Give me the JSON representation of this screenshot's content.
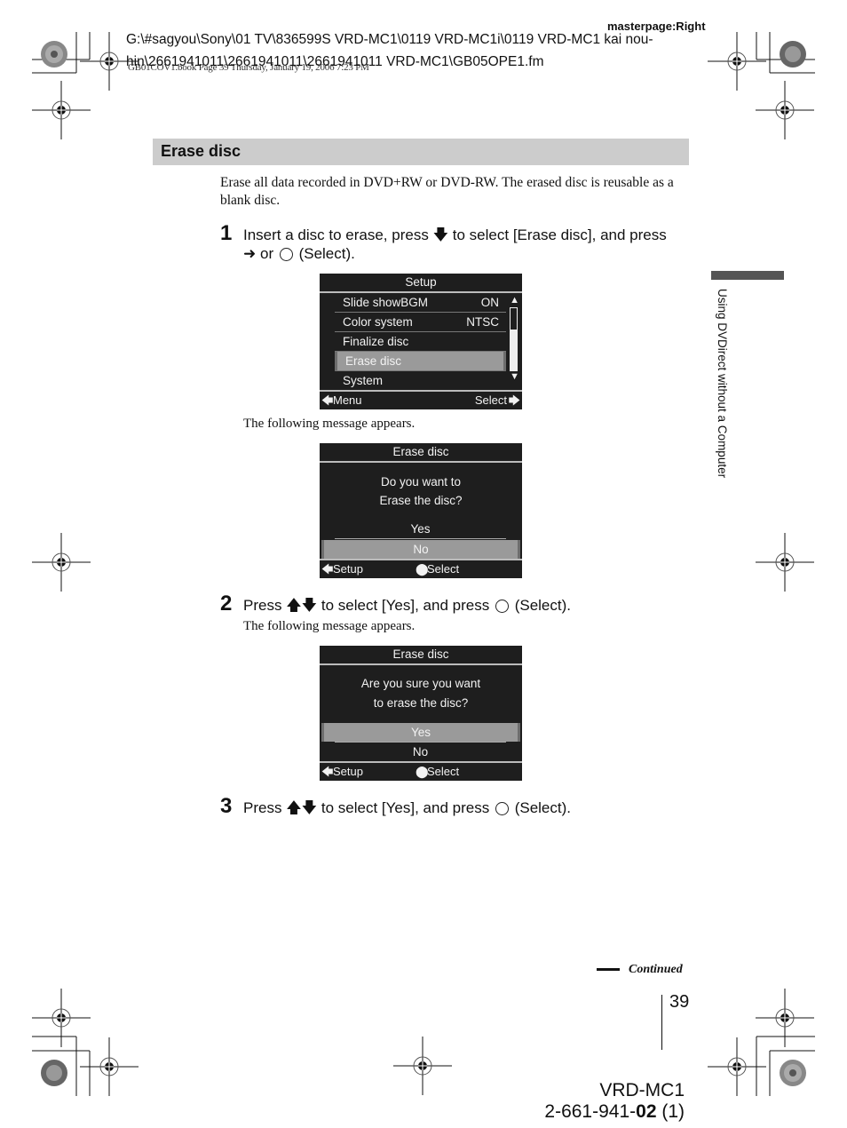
{
  "header": {
    "masterpage": "masterpage:Right",
    "path_line1": "G:\\#sagyou\\Sony\\01 TV\\836599S VRD-MC1\\0119 VRD-MC1i\\0119 VRD-MC1 kai nou-",
    "path_line2": "hin\\2661941011\\2661941011\\2661941011 VRD-MC1\\GB05OPE1.fm",
    "book_line": "GB01COV1.book  Page 39  Thursday, January 19, 2006  7:23 PM"
  },
  "section": {
    "title": "Erase disc",
    "intro": "Erase all data recorded in DVD+RW or DVD-RW. The erased disc is reusable as a blank disc."
  },
  "steps": [
    {
      "number": "1",
      "text_a": "Insert a disc to erase, press",
      "icon_a": "down-arrow",
      "text_b": "to select [Erase disc], and press",
      "icon_b": "right-arrow",
      "text_c": "or",
      "icon_c": "circle-button",
      "text_d": "(Select).",
      "note": "The following message appears."
    },
    {
      "number": "2",
      "text_a": "Press",
      "icon_a": "up-down-arrows",
      "text_b": "to select [Yes], and press",
      "icon_b": "circle-button",
      "text_c": "(Select).",
      "note": "The following message appears."
    },
    {
      "number": "3",
      "text_a": "Press",
      "icon_a": "up-down-arrows",
      "text_b": "to select [Yes], and press",
      "icon_b": "circle-button",
      "text_c": "(Select)."
    }
  ],
  "screens": {
    "setup": {
      "title": "Setup",
      "items": [
        {
          "label": "Slide showBGM",
          "value": "ON"
        },
        {
          "label": "Color system",
          "value": "NTSC"
        },
        {
          "label": "Finalize disc",
          "value": ""
        },
        {
          "label": "Erase disc",
          "value": "",
          "selected": true
        },
        {
          "label": "System",
          "value": ""
        }
      ],
      "footer_left": "Menu",
      "footer_right": "Select"
    },
    "confirm1": {
      "title": "Erase disc",
      "message_line1": "Do you want to",
      "message_line2": "Erase the disc?",
      "options": [
        "Yes",
        "No"
      ],
      "selected": "No",
      "footer_left": "Setup",
      "footer_right": "Select"
    },
    "confirm2": {
      "title": "Erase disc",
      "message_line1": "Are you sure you want",
      "message_line2": "to erase the disc?",
      "options": [
        "Yes",
        "No"
      ],
      "selected": "Yes",
      "footer_left": "Setup",
      "footer_right": "Select"
    }
  },
  "sidebar": {
    "chapter": "Using DVDirect without a Computer"
  },
  "footer": {
    "continued": "Continued",
    "page_number": "39",
    "model": "VRD-MC1",
    "part_prefix": "2-661-941-",
    "part_bold": "02",
    "part_suffix": " (1)"
  }
}
